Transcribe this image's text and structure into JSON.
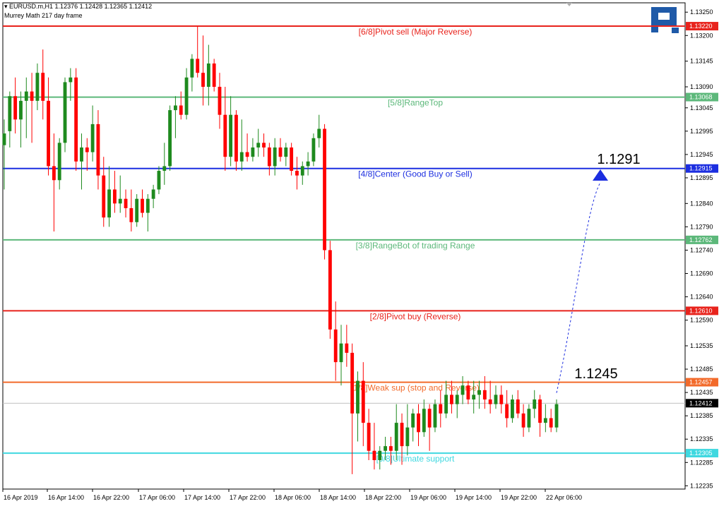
{
  "header": {
    "symbol_line": "EURUSD.m,H1  1.12376 1.12428 1.12365 1.12412",
    "indicator_line": "Murrey Math 217 day frame"
  },
  "colors": {
    "bull": "#1e8a1e",
    "bear": "#ff0000",
    "logo": "#1f5aa8",
    "axis": "#000000"
  },
  "chart_data": {
    "type": "candlestick",
    "symbol": "EURUSD.m",
    "timeframe": "H1",
    "ylim": [
      1.12228,
      1.1327
    ],
    "y_ticks": [
      "1.13250",
      "1.13200",
      "1.13145",
      "1.13090",
      "1.13045",
      "1.12995",
      "1.12945",
      "1.12895",
      "1.12840",
      "1.12790",
      "1.12740",
      "1.12690",
      "1.12640",
      "1.12590",
      "1.12535",
      "1.12485",
      "1.12435",
      "1.12385",
      "1.12335",
      "1.12285",
      "1.12235"
    ],
    "x_ticks": [
      "16 Apr 2019",
      "16 Apr 14:00",
      "16 Apr 22:00",
      "17 Apr 06:00",
      "17 Apr 14:00",
      "17 Apr 22:00",
      "18 Apr 06:00",
      "18 Apr 14:00",
      "18 Apr 22:00",
      "19 Apr 06:00",
      "19 Apr 14:00",
      "19 Apr 22:00",
      "22 Apr 06:00"
    ],
    "levels": [
      {
        "label": "[6/8]Pivot sell (Major Reverse)",
        "value": 1.1322,
        "tag": "1.13220",
        "color": "#e8231c",
        "tag_text": "#ffffff"
      },
      {
        "label": "[5/8]RangeTop",
        "value": 1.13068,
        "tag": "1.13068",
        "color": "#5cb87a",
        "tag_text": "#ffffff"
      },
      {
        "label": "[4/8]Center (Good Buy or Sell)",
        "value": 1.12915,
        "tag": "1.12915",
        "color": "#1c2ee0",
        "tag_text": "#ffffff"
      },
      {
        "label": "[3/8]RangeBot of trading Range",
        "value": 1.12762,
        "tag": "1.12762",
        "color": "#5cb87a",
        "tag_text": "#ffffff"
      },
      {
        "label": "[2/8]Pivot buy (Reverse)",
        "value": 1.1261,
        "tag": "1.12610",
        "color": "#e8231c",
        "tag_text": "#ffffff"
      },
      {
        "label": "[1/8]Weak sup (stop and Reverse)",
        "value": 1.12457,
        "tag": "1.12457",
        "color": "#f26a2a",
        "tag_text": "#ffffff"
      },
      {
        "label": "[0/8]Ultimate support",
        "value": 1.12305,
        "tag": "1.12305",
        "color": "#3fd8e0",
        "tag_text": "#ffffff"
      }
    ],
    "current_price": {
      "value": 1.12412,
      "tag": "1.12412"
    },
    "annotations": [
      {
        "text": "1.1291",
        "value": 1.1291
      },
      {
        "text": "1.1245",
        "value": 1.1245
      }
    ],
    "candles": [
      [
        1.12965,
        1.1302,
        1.1287,
        1.1299
      ],
      [
        1.12995,
        1.1308,
        1.1296,
        1.1307
      ],
      [
        1.1307,
        1.1311,
        1.1299,
        1.1302
      ],
      [
        1.1302,
        1.1308,
        1.1296,
        1.1306
      ],
      [
        1.1306,
        1.1311,
        1.1298,
        1.1308
      ],
      [
        1.1308,
        1.1312,
        1.1297,
        1.1306
      ],
      [
        1.1306,
        1.1314,
        1.1304,
        1.1312
      ],
      [
        1.1312,
        1.1317,
        1.1302,
        1.1306
      ],
      [
        1.1306,
        1.1311,
        1.129,
        1.1292
      ],
      [
        1.1292,
        1.1299,
        1.1278,
        1.1289
      ],
      [
        1.1289,
        1.1298,
        1.1287,
        1.1297
      ],
      [
        1.1297,
        1.1311,
        1.1295,
        1.131
      ],
      [
        1.131,
        1.1313,
        1.1306,
        1.1311
      ],
      [
        1.1311,
        1.1313,
        1.1291,
        1.1293
      ],
      [
        1.1293,
        1.1299,
        1.1287,
        1.1296
      ],
      [
        1.1296,
        1.1298,
        1.1291,
        1.1295
      ],
      [
        1.1295,
        1.1305,
        1.1293,
        1.1301
      ],
      [
        1.1301,
        1.1304,
        1.1287,
        1.129
      ],
      [
        1.129,
        1.1294,
        1.1279,
        1.1281
      ],
      [
        1.1281,
        1.1292,
        1.1279,
        1.1287
      ],
      [
        1.1287,
        1.1291,
        1.1282,
        1.1284
      ],
      [
        1.1284,
        1.129,
        1.1282,
        1.1285
      ],
      [
        1.1285,
        1.1287,
        1.1281,
        1.1283
      ],
      [
        1.1283,
        1.1287,
        1.1278,
        1.128
      ],
      [
        1.128,
        1.1286,
        1.1279,
        1.1285
      ],
      [
        1.1285,
        1.1287,
        1.1281,
        1.1282
      ],
      [
        1.1282,
        1.1286,
        1.1278,
        1.1285
      ],
      [
        1.1285,
        1.1288,
        1.1283,
        1.1287
      ],
      [
        1.1287,
        1.1292,
        1.1286,
        1.1291
      ],
      [
        1.1291,
        1.1297,
        1.1288,
        1.1292
      ],
      [
        1.1292,
        1.1305,
        1.1291,
        1.1304
      ],
      [
        1.1304,
        1.1307,
        1.1298,
        1.1305
      ],
      [
        1.1305,
        1.1308,
        1.1302,
        1.1303
      ],
      [
        1.1303,
        1.1313,
        1.1302,
        1.1311
      ],
      [
        1.1311,
        1.1316,
        1.1308,
        1.1315
      ],
      [
        1.1315,
        1.1322,
        1.1311,
        1.1312
      ],
      [
        1.1312,
        1.132,
        1.1305,
        1.1309
      ],
      [
        1.1309,
        1.1318,
        1.1305,
        1.1314
      ],
      [
        1.1314,
        1.1315,
        1.1308,
        1.1309
      ],
      [
        1.1309,
        1.1312,
        1.13,
        1.1303
      ],
      [
        1.1303,
        1.1309,
        1.1291,
        1.1294
      ],
      [
        1.1294,
        1.1307,
        1.1292,
        1.1303
      ],
      [
        1.1303,
        1.1304,
        1.1291,
        1.1293
      ],
      [
        1.1293,
        1.1302,
        1.1291,
        1.1295
      ],
      [
        1.1295,
        1.1299,
        1.1293,
        1.1294
      ],
      [
        1.1294,
        1.1298,
        1.1293,
        1.1296
      ],
      [
        1.1296,
        1.13,
        1.1294,
        1.1297
      ],
      [
        1.1297,
        1.1299,
        1.1294,
        1.1296
      ],
      [
        1.1296,
        1.1297,
        1.129,
        1.1292
      ],
      [
        1.1292,
        1.1298,
        1.129,
        1.1296
      ],
      [
        1.1296,
        1.1298,
        1.1293,
        1.1294
      ],
      [
        1.1294,
        1.1297,
        1.1292,
        1.1296
      ],
      [
        1.1296,
        1.1297,
        1.129,
        1.1291
      ],
      [
        1.1291,
        1.1294,
        1.1287,
        1.129
      ],
      [
        1.129,
        1.1293,
        1.1288,
        1.1292
      ],
      [
        1.1292,
        1.1295,
        1.129,
        1.1293
      ],
      [
        1.1293,
        1.1299,
        1.1292,
        1.1298
      ],
      [
        1.1298,
        1.1303,
        1.1296,
        1.13
      ],
      [
        1.13,
        1.1301,
        1.1272,
        1.1274
      ],
      [
        1.1274,
        1.1276,
        1.1255,
        1.1257
      ],
      [
        1.1257,
        1.1263,
        1.1246,
        1.125
      ],
      [
        1.125,
        1.1258,
        1.1245,
        1.1254
      ],
      [
        1.1254,
        1.1258,
        1.1249,
        1.1252
      ],
      [
        1.1252,
        1.1254,
        1.1226,
        1.1239
      ],
      [
        1.1239,
        1.1248,
        1.1233,
        1.1246
      ],
      [
        1.1246,
        1.125,
        1.1232,
        1.1237
      ],
      [
        1.1237,
        1.124,
        1.1229,
        1.1231
      ],
      [
        1.1231,
        1.1237,
        1.1227,
        1.1229
      ],
      [
        1.1229,
        1.1232,
        1.1227,
        1.1231
      ],
      [
        1.1231,
        1.1234,
        1.1229,
        1.1232
      ],
      [
        1.1232,
        1.1234,
        1.1228,
        1.1231
      ],
      [
        1.1231,
        1.1241,
        1.1229,
        1.1237
      ],
      [
        1.1237,
        1.1239,
        1.1228,
        1.1232
      ],
      [
        1.1232,
        1.1241,
        1.123,
        1.1236
      ],
      [
        1.1236,
        1.124,
        1.1233,
        1.1239
      ],
      [
        1.1239,
        1.1241,
        1.1232,
        1.1235
      ],
      [
        1.1235,
        1.1242,
        1.1234,
        1.124
      ],
      [
        1.124,
        1.1241,
        1.1231,
        1.1236
      ],
      [
        1.1236,
        1.1242,
        1.1235,
        1.1241
      ],
      [
        1.1241,
        1.1244,
        1.1236,
        1.1239
      ],
      [
        1.1239,
        1.1246,
        1.1238,
        1.1243
      ],
      [
        1.1243,
        1.1246,
        1.1239,
        1.1241
      ],
      [
        1.1241,
        1.1244,
        1.1238,
        1.1243
      ],
      [
        1.1243,
        1.1247,
        1.1241,
        1.1245
      ],
      [
        1.1245,
        1.1246,
        1.1241,
        1.1242
      ],
      [
        1.1242,
        1.1246,
        1.1239,
        1.1243
      ],
      [
        1.1243,
        1.1246,
        1.124,
        1.1244
      ],
      [
        1.1244,
        1.1247,
        1.124,
        1.1242
      ],
      [
        1.1242,
        1.1246,
        1.1239,
        1.1241
      ],
      [
        1.1241,
        1.1245,
        1.124,
        1.1243
      ],
      [
        1.1243,
        1.1245,
        1.1239,
        1.1241
      ],
      [
        1.1241,
        1.1244,
        1.1236,
        1.1238
      ],
      [
        1.1238,
        1.1243,
        1.1237,
        1.1242
      ],
      [
        1.1242,
        1.1244,
        1.1238,
        1.1239
      ],
      [
        1.1239,
        1.1241,
        1.1234,
        1.1236
      ],
      [
        1.1236,
        1.1241,
        1.1235,
        1.124
      ],
      [
        1.124,
        1.1244,
        1.1238,
        1.1242
      ],
      [
        1.1242,
        1.1243,
        1.1234,
        1.1237
      ],
      [
        1.1237,
        1.1241,
        1.1235,
        1.1238
      ],
      [
        1.1238,
        1.124,
        1.1235,
        1.1236
      ],
      [
        1.1236,
        1.1242,
        1.1235,
        1.1241
      ]
    ]
  }
}
